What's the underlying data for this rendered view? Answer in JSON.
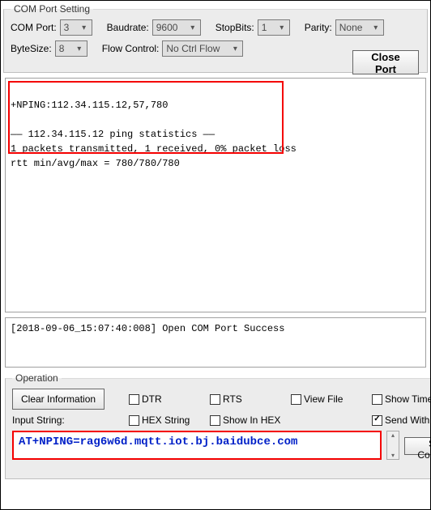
{
  "com_setting": {
    "legend": "COM Port Setting",
    "com_port_label": "COM Port:",
    "com_port_value": "3",
    "baudrate_label": "Baudrate:",
    "baudrate_value": "9600",
    "stopbits_label": "StopBits:",
    "stopbits_value": "1",
    "parity_label": "Parity:",
    "parity_value": "None",
    "bytesize_label": "ByteSize:",
    "bytesize_value": "8",
    "flowcontrol_label": "Flow Control:",
    "flowcontrol_value": "No Ctrl Flow",
    "close_port_label": "Close Port"
  },
  "output": {
    "text": "\n+NPING:112.34.115.12,57,780\n\n—— 112.34.115.12 ping statistics ——\n1 packets transmitted, 1 received, 0% packet loss\nrtt min/avg/max = 780/780/780"
  },
  "log": {
    "text": "[2018-09-06_15:07:40:008] Open COM Port Success"
  },
  "operation": {
    "legend": "Operation",
    "clear_info_label": "Clear Information",
    "checks": {
      "dtr": "DTR",
      "rts": "RTS",
      "view_file": "View File",
      "show_time": "Show Time",
      "hex_string": "HEX String",
      "show_in_hex": "Show In HEX",
      "send_with_enter": "Send With Enter"
    },
    "input_string_label": "Input String:",
    "input_string_value": "AT+NPING=rag6w6d.mqtt.iot.bj.baidubce.com",
    "send_command_label": "Send Command"
  }
}
